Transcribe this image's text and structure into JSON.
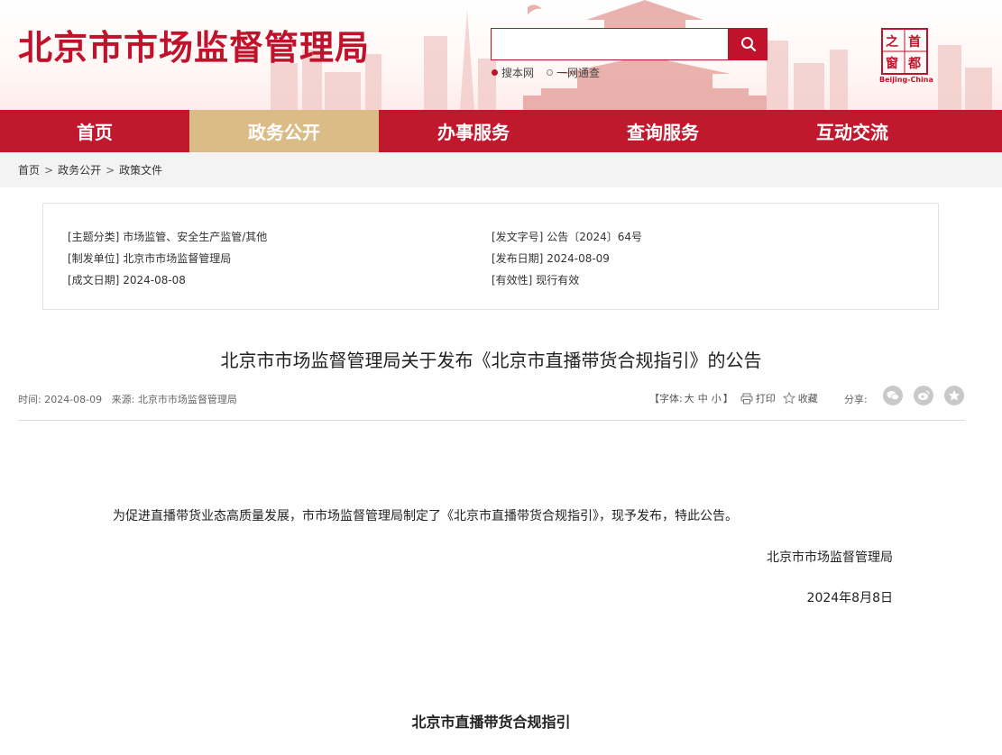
{
  "header": {
    "site_title": "北京市市场监督管理局",
    "search": {
      "placeholder": "",
      "options": [
        {
          "label": "搜本网",
          "selected": true
        },
        {
          "label": "一网通查",
          "selected": false
        }
      ]
    },
    "seal": {
      "chars": [
        "之",
        "首",
        "窗",
        "都"
      ],
      "caption": "Beijing-China"
    }
  },
  "nav": [
    {
      "label": "首页",
      "active": false
    },
    {
      "label": "政务公开",
      "active": true
    },
    {
      "label": "办事服务",
      "active": false
    },
    {
      "label": "查询服务",
      "active": false
    },
    {
      "label": "互动交流",
      "active": false
    }
  ],
  "breadcrumb": [
    "首页",
    "政务公开",
    "政策文件"
  ],
  "breadcrumb_sep": ">",
  "meta": {
    "topic_label": "[主题分类]",
    "topic_value": "市场监管、安全生产监管/其他",
    "doc_no_label": "[发文字号]",
    "doc_no_value": "公告〔2024〕64号",
    "issuer_label": "[制发单位]",
    "issuer_value": "北京市市场监督管理局",
    "publish_label": "[发布日期]",
    "publish_value": "2024-08-09",
    "created_label": "[成文日期]",
    "created_value": "2024-08-08",
    "validity_label": "[有效性]",
    "validity_value": "现行有效"
  },
  "article": {
    "title": "北京市市场监督管理局关于发布《北京市直播带货合规指引》的公告",
    "time_label": "时间:",
    "time_value": "2024-08-09",
    "source_label": "来源:",
    "source_value": "北京市市场监督管理局",
    "font_label": "【字体:",
    "font_big": "大",
    "font_mid": "中",
    "font_small": "小",
    "font_end": "】",
    "print_label": "打印",
    "fav_label": "收藏",
    "share_label": "分享:",
    "paragraph": "为促进直播带货业态高质量发展，市市场监督管理局制定了《北京市直播带货合规指引》，现予发布，特此公告。",
    "signature": "北京市市场监督管理局",
    "date": "2024年8月8日",
    "subheading": "北京市直播带货合规指引"
  },
  "colors": {
    "brand_red": "#c0182d",
    "active_tab": "#dcbc86"
  }
}
